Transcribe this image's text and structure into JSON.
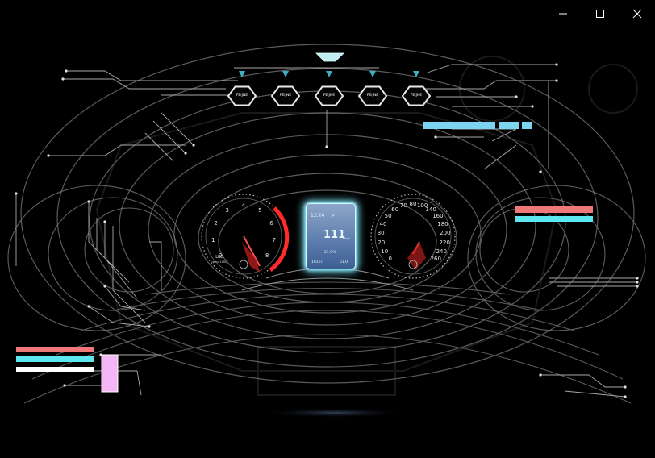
{
  "window": {
    "controls": {
      "minimize": "minimize-icon",
      "maximize": "maximize-icon",
      "close": "close-icon"
    }
  },
  "top_hexes": [
    {
      "label": "FEIJNE"
    },
    {
      "label": "FEIJNE"
    },
    {
      "label": "FEIJNE"
    },
    {
      "label": "FEIJNE"
    },
    {
      "label": "FEIJNE"
    }
  ],
  "left_gauge": {
    "ticks": [
      "0",
      "1",
      "2",
      "3",
      "4",
      "5",
      "6",
      "7",
      "8"
    ],
    "caption_top": "LKB",
    "caption_bottom": "rpm×1000"
  },
  "right_gauge": {
    "ticks": [
      "0",
      "10",
      "20",
      "30",
      "40",
      "50",
      "60",
      "70",
      "80",
      "100",
      "140",
      "160",
      "180",
      "200",
      "220",
      "240",
      "260"
    ]
  },
  "center_screen": {
    "time": "12:24",
    "indicator": "P",
    "speed": "111",
    "speed_unit": "km/h",
    "temp": "21.9℃",
    "odo_label": "1016T",
    "odo_value": "61.0"
  },
  "colors": {
    "accent_cyan": "#5ee6ee",
    "accent_red": "#f07878",
    "bar_blue": "#7dd3f2",
    "pink": "#f4b6f4"
  }
}
